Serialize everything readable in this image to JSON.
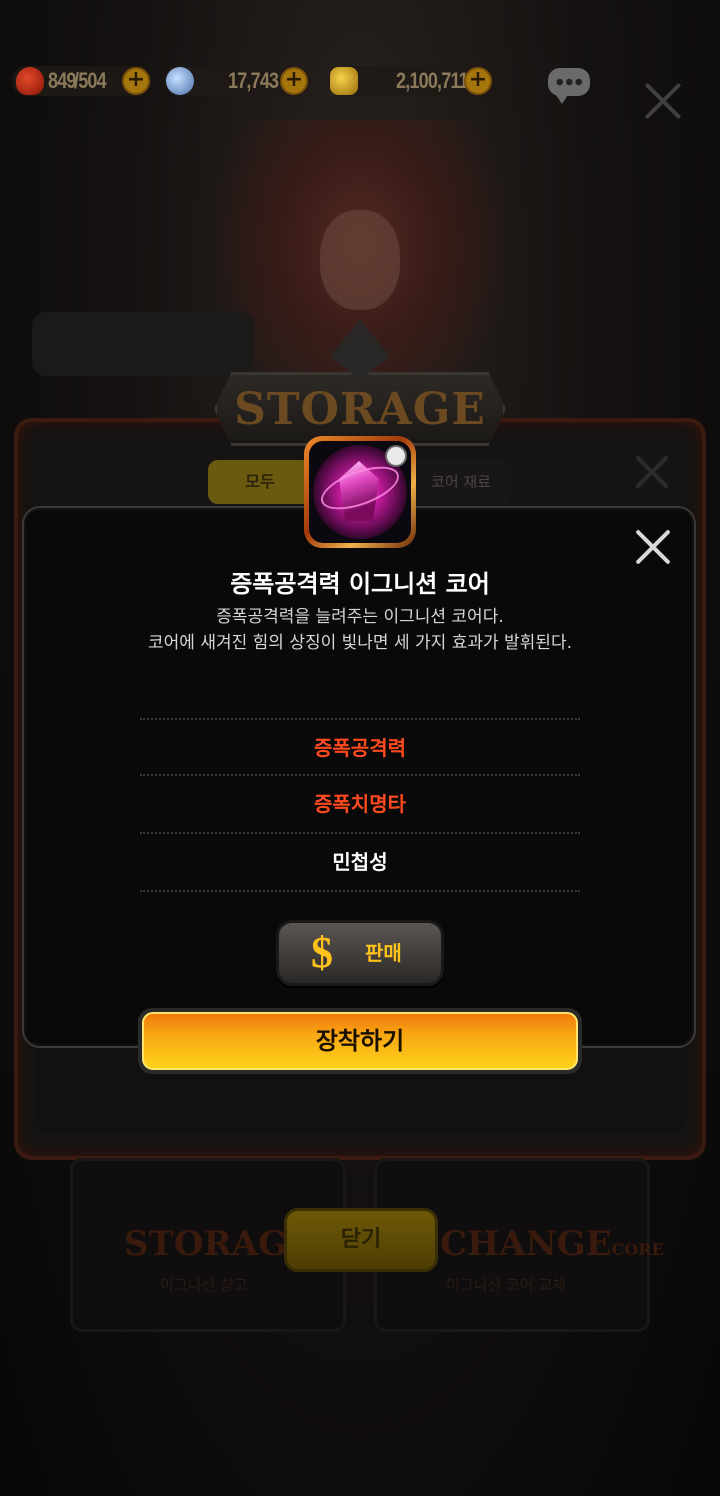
{
  "resources": {
    "stamina": "849",
    "stamina_max": "/504",
    "gems": "17,743",
    "gold": "2,100,711",
    "plus_symbol": "+"
  },
  "storage": {
    "banner": "STORAGE",
    "tab_all": "모두",
    "tab_core": "코어 재료",
    "cards": [
      {
        "title": "STORAGE",
        "subtitle": "이그니션 창고"
      },
      {
        "title": "CHANGE",
        "title_suffix": "CORE",
        "subtitle": "이그니션 코어 교체"
      }
    ],
    "close_label": "닫기"
  },
  "popup": {
    "item_name": "증폭공격력 이그니션 코어",
    "description_line1": "증폭공격력을 늘려주는 이그니션 코어다.",
    "description_line2": "코어에 새겨진 힘의 상징이 빛나면 세 가지 효과가 발휘된다.",
    "options": [
      "증폭공격력",
      "증폭치명타",
      "민첩성"
    ],
    "sell_label": "판매",
    "sell_icon": "$",
    "equip_label": "장착하기"
  },
  "colors": {
    "option_active": "#ff4a1e",
    "option_inactive": "#ffffff",
    "equip_button": "#f8a814",
    "sell_text": "#ffc21a"
  }
}
